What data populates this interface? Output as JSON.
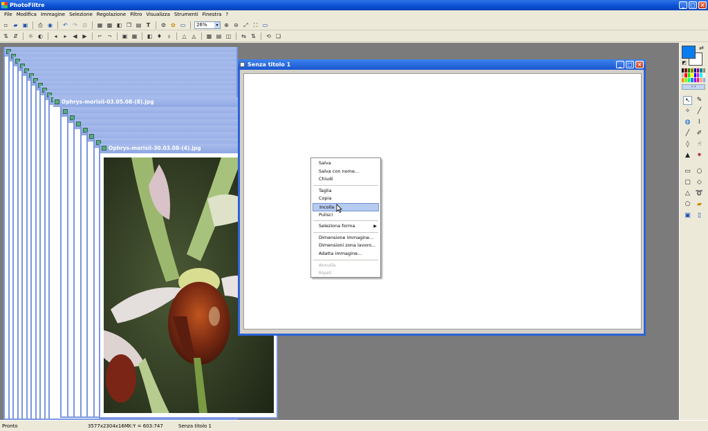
{
  "app": {
    "title": "PhotoFiltre"
  },
  "menu": [
    "File",
    "Modifica",
    "Immagine",
    "Selezione",
    "Regolazione",
    "Filtro",
    "Visualizza",
    "Strumenti",
    "Finestra",
    "?"
  ],
  "zoom": {
    "value": "26%"
  },
  "windows": {
    "stack_title_1": "Ophrys-morisii-03.05.08-(8).jpg",
    "stack_title_2": "Ophrys-morisii-30.03.08-(4).jpg",
    "active_title": "Senza titolo 1"
  },
  "context_menu": {
    "items": [
      "Salva",
      "Salva con nome...",
      "Chiudi",
      "Taglia",
      "Copia",
      "Incolla",
      "Pulisci",
      "Seleziona forma",
      "Dimensione immagine...",
      "Dimensioni zona lavoro...",
      "Adatta immagine...",
      "Annulla",
      "Ripeti"
    ],
    "highlighted": "Incolla"
  },
  "status": {
    "state": "Pronto",
    "size": "3577x2304x16M",
    "coords": "X:Y = 603:747",
    "doc": "Senza titolo 1"
  },
  "colors": {
    "foreground": "#0a7df0",
    "background": "#ffffff",
    "title_active": "#0a4fd4",
    "workspace": "#7b7b7b"
  },
  "icons": {
    "toolbar1": [
      "new-icon",
      "open-icon",
      "save-icon",
      "print-icon",
      "scan-icon",
      "undo-icon",
      "redo-icon",
      "crop-icon",
      "grayscale-icon",
      "rgb-icon",
      "adjust-icon",
      "copy-icon",
      "paste-icon",
      "text-icon",
      "plugin-icon",
      "stamp-icon",
      "gallery-icon",
      "zoom-in-icon",
      "zoom-out-icon",
      "fit-icon",
      "fullscreen-icon",
      "screen-icon"
    ],
    "right_tools": [
      "select-icon",
      "eyedropper-icon",
      "magic-wand-icon",
      "line-icon",
      "fill-icon",
      "spray-icon",
      "brush-icon",
      "pen-icon",
      "drop-icon",
      "smudge-icon",
      "clone-icon",
      "gear-icon",
      "rectangle-icon",
      "ellipse-icon",
      "rounded-rect-icon",
      "diamond-icon",
      "triangle-icon",
      "lasso-icon",
      "polygon-icon",
      "folder-icon"
    ]
  }
}
